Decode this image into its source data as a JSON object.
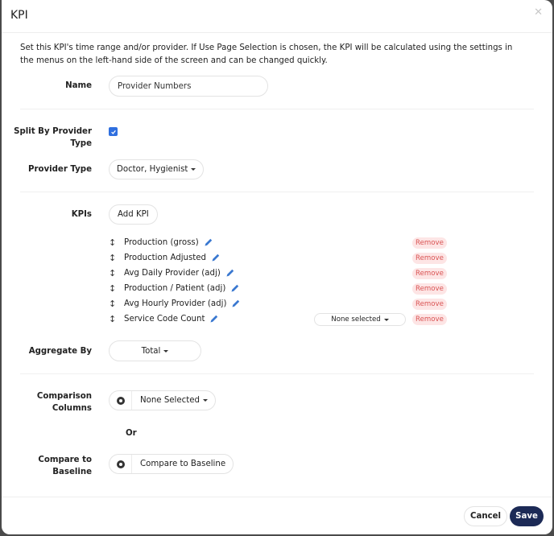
{
  "modal": {
    "title": "KPI",
    "close_icon": "close-icon",
    "intro": "Set this KPI's time range and/or provider. If Use Page Selection is chosen, the KPI will be calculated using the settings in the menus on the left-hand side of the screen and can be changed quickly."
  },
  "form": {
    "name": {
      "label": "Name",
      "value": "Provider Numbers"
    },
    "split_by_provider_type": {
      "label": "Split By Provider Type",
      "checked": true
    },
    "provider_type": {
      "label": "Provider Type",
      "value": "Doctor, Hygienist"
    },
    "kpis": {
      "label": "KPIs",
      "add_label": "Add KPI",
      "remove_label": "Remove",
      "items": [
        {
          "name": "Production (gross)"
        },
        {
          "name": "Production Adjusted"
        },
        {
          "name": "Avg Daily Provider (adj)"
        },
        {
          "name": "Production / Patient (adj)"
        },
        {
          "name": "Avg Hourly Provider (adj)"
        },
        {
          "name": "Service Code Count",
          "select_value": "None selected"
        }
      ]
    },
    "aggregate_by": {
      "label": "Aggregate By",
      "value": "Total"
    },
    "comparison_columns": {
      "label": "Comparison Columns",
      "value": "None Selected"
    },
    "or_text": "Or",
    "compare_to_baseline": {
      "label": "Compare to Baseline",
      "value": "Compare to Baseline"
    }
  },
  "footer": {
    "cancel_label": "Cancel",
    "save_label": "Save"
  },
  "colors": {
    "primary": "#1c2a56",
    "checkbox": "#2f6fdf",
    "edit_icon": "#3a78d0",
    "remove_text": "#d95454",
    "remove_bg": "#fde5e5"
  }
}
